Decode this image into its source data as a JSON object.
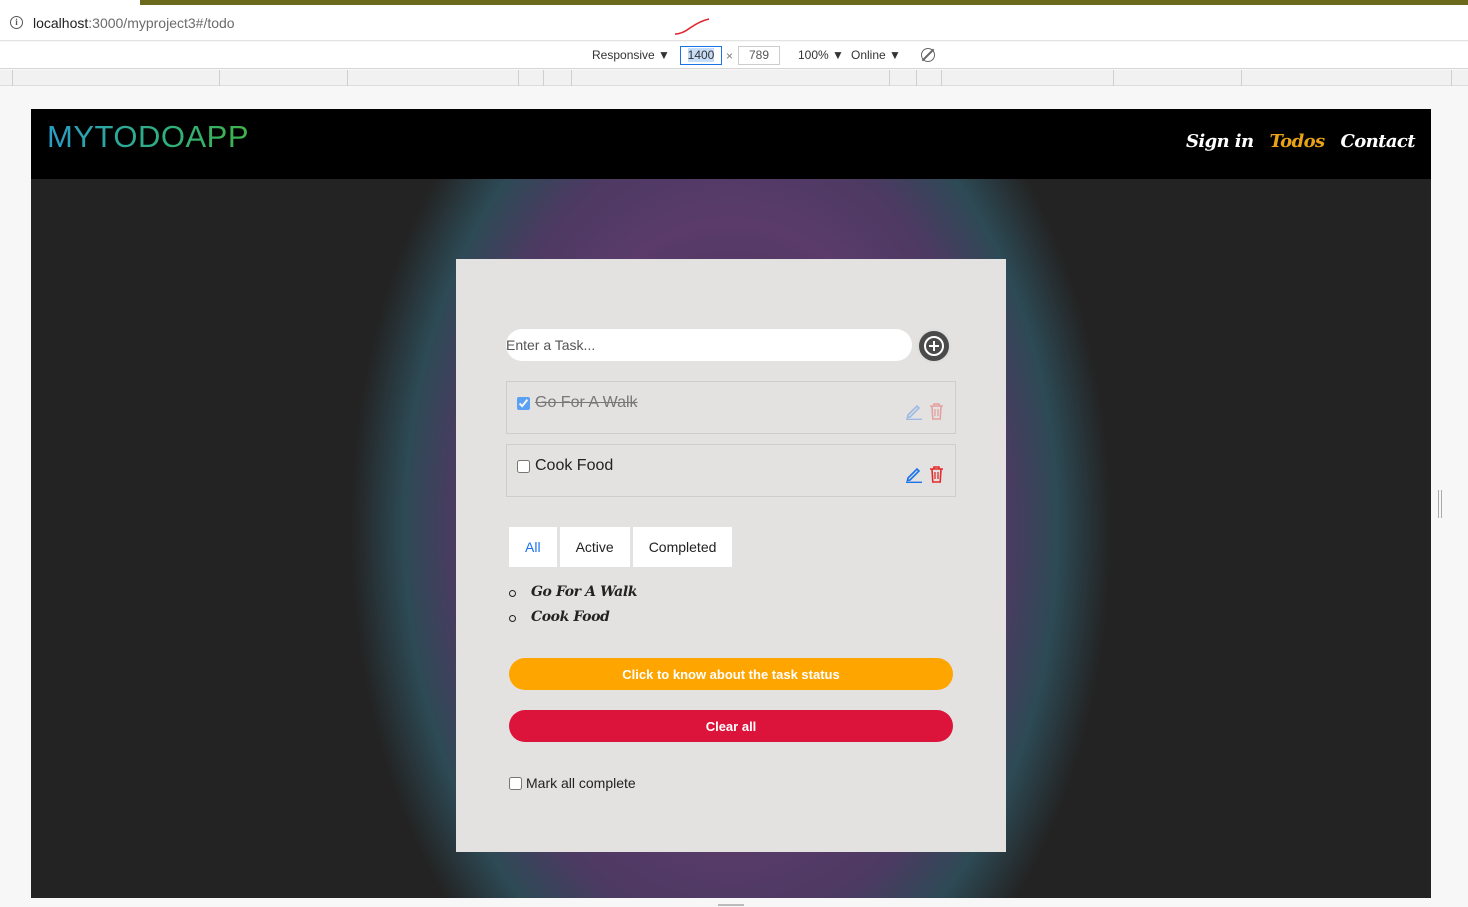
{
  "browser": {
    "url_host": "localhost",
    "url_rest": ":3000/myproject3#/todo",
    "device_mode": "Responsive ▼",
    "width": "1400",
    "times": "×",
    "height": "789",
    "zoom": "100% ▼",
    "network": "Online ▼"
  },
  "navbar": {
    "brand": "MYTODOAPP",
    "links": [
      "Sign in",
      "Todos",
      "Contact"
    ],
    "active_link": "Todos"
  },
  "form": {
    "placeholder": "Enter a Task..."
  },
  "todos": [
    {
      "label": "Go For A Walk",
      "completed": true
    },
    {
      "label": "Cook Food",
      "completed": false
    }
  ],
  "filters": {
    "tabs": [
      "All",
      "Active",
      "Completed"
    ],
    "active": "All"
  },
  "task_list": [
    "Go For A Walk",
    "Cook Food"
  ],
  "buttons": {
    "status": "Click to know about the task status",
    "clear": "Clear all"
  },
  "mark_all_label": "Mark all complete",
  "colors": {
    "navbar_bg": "#000000",
    "active_link": "#e8a317",
    "status_button": "#ffa500",
    "clear_button": "#dc143c",
    "card_bg": "#e4e2e1"
  }
}
